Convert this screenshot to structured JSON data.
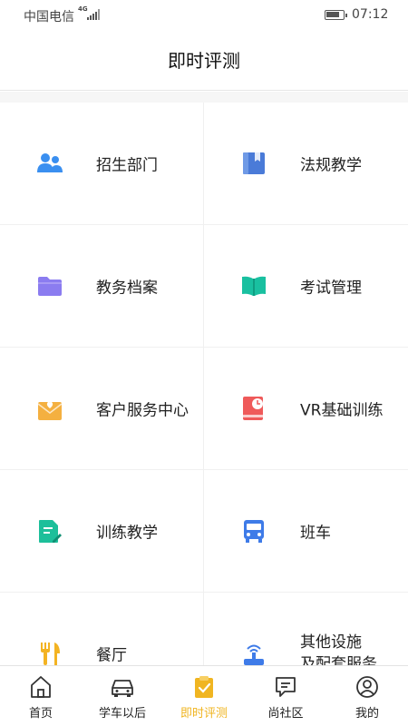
{
  "status": {
    "carrier": "中国电信",
    "network": "4G",
    "time": "07:12"
  },
  "header": {
    "title": "即时评测"
  },
  "grid": [
    {
      "label": "招生部门",
      "icon": "people-icon",
      "color": "#3a8ff0"
    },
    {
      "label": "法规教学",
      "icon": "book-icon",
      "color": "#4a7bd8"
    },
    {
      "label": "教务档案",
      "icon": "folder-icon",
      "color": "#8b7cf0"
    },
    {
      "label": "考试管理",
      "icon": "open-book-icon",
      "color": "#19c0a0"
    },
    {
      "label": "客户服务中心",
      "icon": "service-box-icon",
      "color": "#f4b040"
    },
    {
      "label": "VR基础训练",
      "icon": "vr-book-icon",
      "color": "#ef5a5a"
    },
    {
      "label": "训练教学",
      "icon": "edit-doc-icon",
      "color": "#1dbf9a"
    },
    {
      "label": "班车",
      "icon": "bus-icon",
      "color": "#3e7be8"
    },
    {
      "label": "餐厅",
      "icon": "fork-knife-icon",
      "color": "#f3b322"
    },
    {
      "label_line1": "其他设施",
      "label_line2": "及配套服务",
      "icon": "antenna-icon",
      "color": "#3e7be8"
    }
  ],
  "tabs": [
    {
      "label": "首页",
      "icon": "home-icon"
    },
    {
      "label": "学车以后",
      "icon": "car-icon"
    },
    {
      "label": "即时评测",
      "icon": "clipboard-check-icon",
      "active": true
    },
    {
      "label": "尚社区",
      "icon": "chat-icon"
    },
    {
      "label": "我的",
      "icon": "user-icon"
    }
  ],
  "colors": {
    "accent": "#f0b521",
    "text": "#222222",
    "divider": "#f0f0f0"
  }
}
